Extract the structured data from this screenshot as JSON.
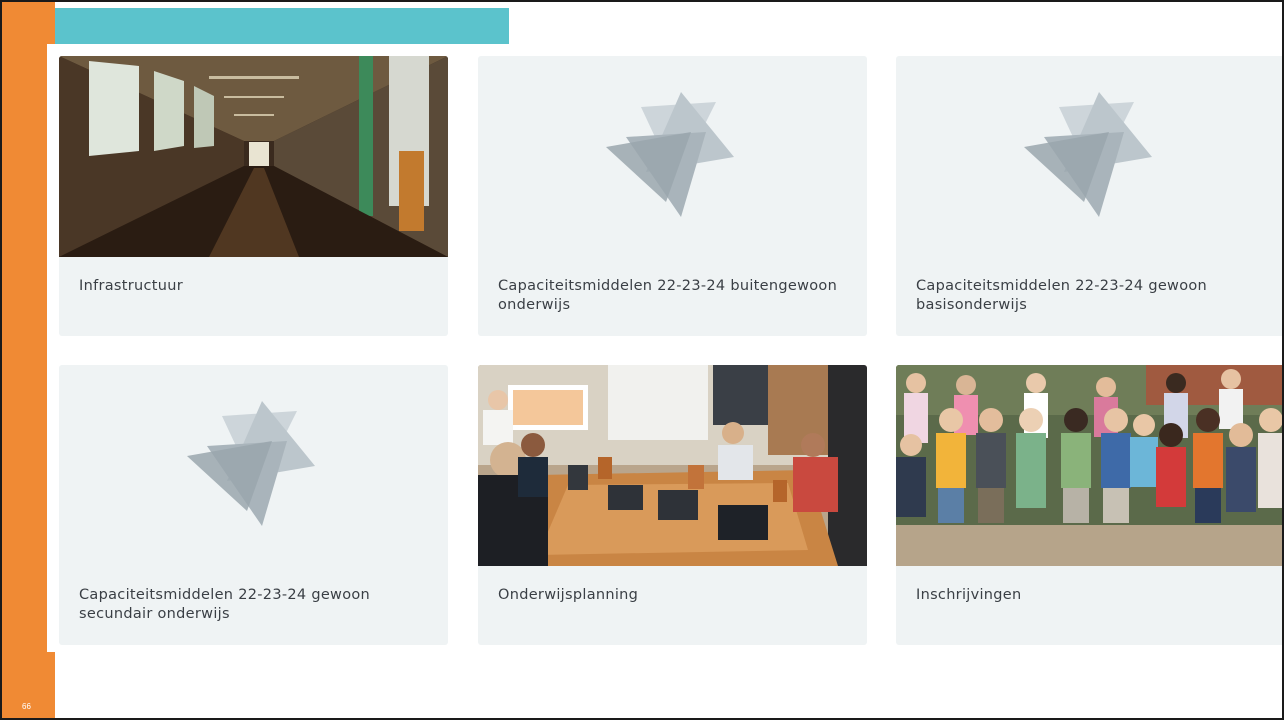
{
  "slide": {
    "number": "66"
  },
  "colors": {
    "orange": "#f08a34",
    "teal": "#5bc3cc",
    "card_bg": "#eff3f4"
  },
  "cards": [
    {
      "label": "Infrastructuur",
      "media": "hallway-photo"
    },
    {
      "label": "Capaciteitsmiddelen 22-23-24 buitengewoon onderwijs",
      "media": "placeholder-logo-icon"
    },
    {
      "label": "Capaciteitsmiddelen 22-23-24 gewoon basisonderwijs",
      "media": "placeholder-logo-icon"
    },
    {
      "label": "Capaciteitsmiddelen 22-23-24 gewoon secundair onderwijs",
      "media": "placeholder-logo-icon"
    },
    {
      "label": "Onderwijsplanning",
      "media": "meeting-photo"
    },
    {
      "label": "Inschrijvingen",
      "media": "children-photo"
    }
  ]
}
